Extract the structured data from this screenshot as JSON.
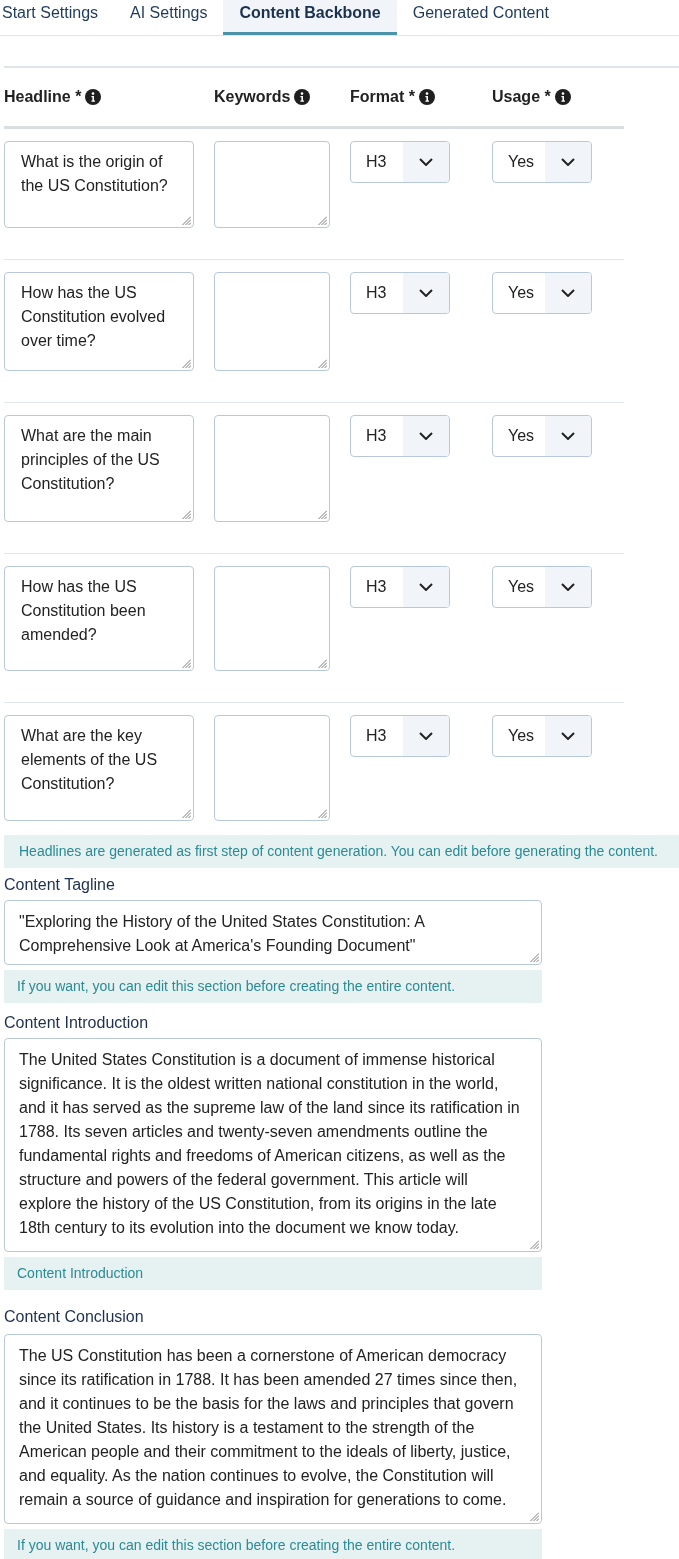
{
  "tabs": [
    {
      "label": "Start Settings",
      "selected": false
    },
    {
      "label": "AI Settings",
      "selected": false
    },
    {
      "label": "Content Backbone",
      "selected": true
    },
    {
      "label": "Generated Content",
      "selected": false
    }
  ],
  "headline_table": {
    "columns": [
      {
        "label": "Headline *"
      },
      {
        "label": "Keywords"
      },
      {
        "label": "Format *"
      },
      {
        "label": "Usage *"
      }
    ],
    "rows": [
      {
        "headline": "What is the origin of the US Constitution?",
        "format": "H3",
        "usage": "Yes"
      },
      {
        "headline": "How has the US Constitution evolved over time?",
        "format": "H3",
        "usage": "Yes"
      },
      {
        "headline": "What are the main principles of the US Constitution?",
        "format": "H3",
        "usage": "Yes"
      },
      {
        "headline": "How has the US Constitution been amended?",
        "format": "H3",
        "usage": "Yes"
      },
      {
        "headline": "What are the key elements of the US Constitution?",
        "format": "H3",
        "usage": "Yes"
      }
    ]
  },
  "headline_note": "Headlines are generated as first step of content generation. You can edit before generating the content.",
  "sections": [
    {
      "label": "Content Tagline",
      "text": "\"Exploring the History of the United States Constitution: A Comprehensive Look at America's Founding Document\"",
      "note": "If you want, you can edit this section before creating the entire content."
    },
    {
      "label": "Content Introduction",
      "text": "The United States Constitution is a document of immense historical significance. It is the oldest written national constitution in the world, and it has served as the supreme law of the land since its ratification in 1788. Its seven articles and twenty-seven amendments outline the fundamental rights and freedoms of American citizens, as well as the structure and powers of the federal government. This article will explore the history of the US Constitution, from its origins in the late 18th century to its evolution into the document we know today.",
      "note": "Content Introduction"
    },
    {
      "label": "Content Conclusion",
      "text": "The US Constitution has been a cornerstone of American democracy since its ratification in 1788. It has been amended 27 times since then, and it continues to be the basis for the laws and principles that govern the United States. Its history is a testament to the strength of the American people and their commitment to the ideals of liberty, justice, and equality. As the nation continues to evolve, the Constitution will remain a source of guidance and inspiration for generations to come.",
      "note": "If you want, you can edit this section before creating the entire content."
    }
  ]
}
